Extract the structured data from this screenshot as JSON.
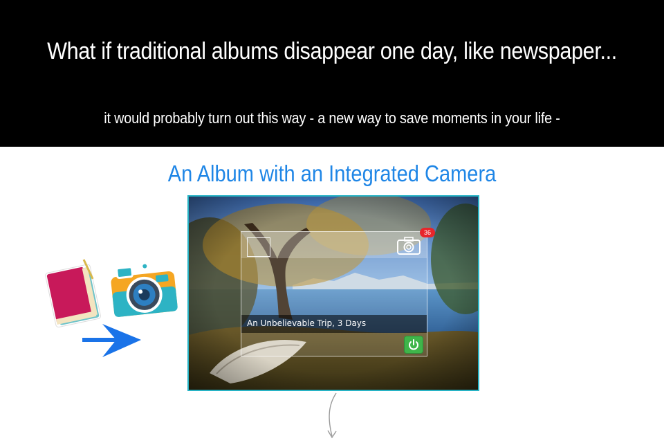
{
  "banner": {
    "headline": "What if traditional albums disappear one day, like newspaper...",
    "subline": "it would probably turn out this way - a new way to save moments in your life -"
  },
  "section": {
    "title": "An Album with an Integrated Camera"
  },
  "widget": {
    "badge_count": "36",
    "caption": "An Unbelievable Trip, 3 Days",
    "camera_icon": "camera-icon",
    "power_icon": "power-icon"
  },
  "icons": {
    "album": "album-book-icon",
    "camera": "retro-camera-icon",
    "arrow_right": "arrow-right-icon",
    "arrow_down": "curved-arrow-down-icon"
  },
  "colors": {
    "banner_bg": "#000000",
    "title_blue": "#1f86e6",
    "frame_border": "#27b3c5",
    "badge_red": "#e8252a",
    "power_green": "#3fb54a",
    "arrow_blue": "#1a73e8"
  }
}
